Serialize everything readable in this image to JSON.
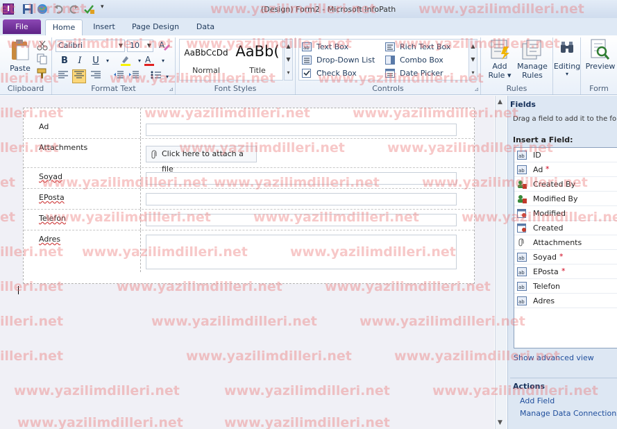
{
  "titlebar": {
    "title": "(Design) Form2 - Microsoft InfoPath"
  },
  "tabs": {
    "file": "File",
    "items": [
      "Home",
      "Insert",
      "Page Design",
      "Data"
    ],
    "active": "Home"
  },
  "ribbon": {
    "clipboard": {
      "label": "Clipboard",
      "paste": "Paste"
    },
    "format_text": {
      "label": "Format Text",
      "font": "Calibri",
      "size": "10"
    },
    "font_styles": {
      "label": "Font Styles",
      "normal_sample": "AaBbCcDd",
      "normal": "Normal",
      "title_sample": "AaBb(",
      "title": "Title"
    },
    "controls": {
      "label": "Controls",
      "items": [
        "Text Box",
        "Drop-Down List ...",
        "Check Box",
        "Rich Text Box",
        "Combo Box",
        "Date Picker"
      ]
    },
    "rules": {
      "label": "Rules",
      "add_rule": [
        "Add",
        "Rule"
      ],
      "manage_rules": [
        "Manage",
        "Rules"
      ]
    },
    "editing": {
      "label": "Editing"
    },
    "form": {
      "label": "Form",
      "preview": "Preview"
    }
  },
  "form": {
    "rows": [
      {
        "label": "Ad"
      },
      {
        "label": "Attachments",
        "button": "Click here to attach a file"
      },
      {
        "label": "Soyad"
      },
      {
        "label": "EPosta"
      },
      {
        "label": "Telefon"
      },
      {
        "label": "Adres"
      }
    ]
  },
  "fields_pane": {
    "title": "Fields",
    "description": "Drag a field to add it to the form.",
    "insert_label": "Insert a Field:",
    "fields": [
      {
        "name": "ID",
        "required": false,
        "icon": "text-field-icon"
      },
      {
        "name": "Ad",
        "required": true,
        "icon": "text-field-icon"
      },
      {
        "name": "Created By",
        "required": false,
        "icon": "person-field-icon"
      },
      {
        "name": "Modified By",
        "required": false,
        "icon": "person-field-icon"
      },
      {
        "name": "Modified",
        "required": false,
        "icon": "date-field-icon"
      },
      {
        "name": "Created",
        "required": false,
        "icon": "date-field-icon"
      },
      {
        "name": "Attachments",
        "required": false,
        "icon": "paperclip-icon"
      },
      {
        "name": "Soyad",
        "required": true,
        "icon": "text-field-icon"
      },
      {
        "name": "EPosta",
        "required": true,
        "icon": "text-field-icon"
      },
      {
        "name": "Telefon",
        "required": false,
        "icon": "text-field-icon"
      },
      {
        "name": "Adres",
        "required": false,
        "icon": "text-field-icon"
      }
    ],
    "required_mark": "*",
    "advanced_link": "Show advanced view",
    "actions_title": "Actions",
    "actions": [
      "Add Field",
      "Manage Data Connections..."
    ]
  },
  "watermark": "www.yazilimdilleri.net",
  "watermark_partial": "lleri.net",
  "watermark_partial2": "illeri.net",
  "watermark_partial3": "et",
  "colors": {
    "file_tab": "#6e2a99",
    "accent": "#1e395b",
    "required": "#d0021b",
    "link": "#1f4e9c"
  }
}
